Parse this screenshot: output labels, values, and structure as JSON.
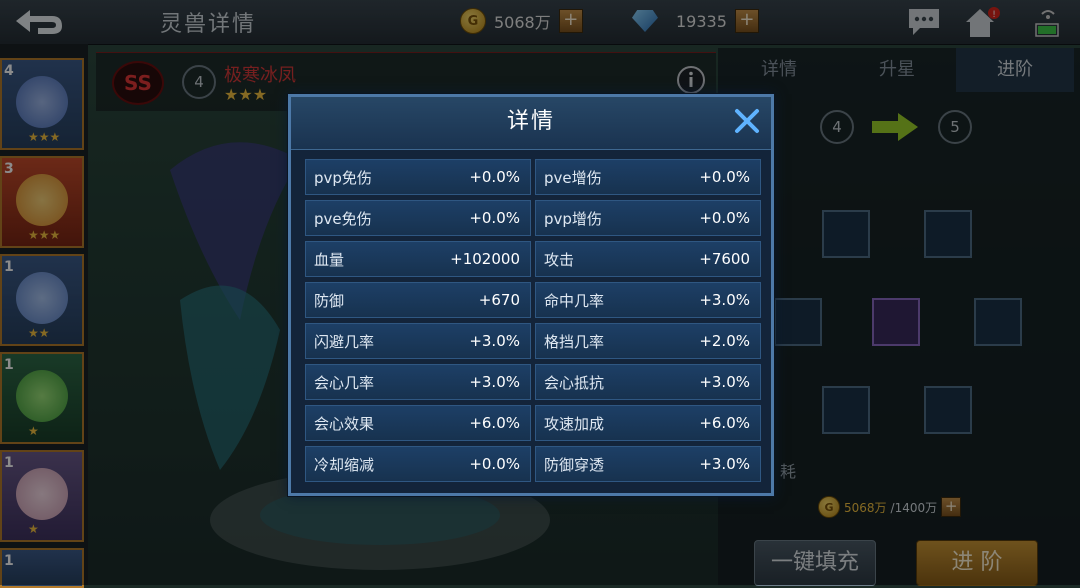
{
  "header": {
    "title": "灵兽详情",
    "gold": "5068万",
    "diamond": "19335"
  },
  "pet": {
    "grade": "SS",
    "level": "4",
    "name": "极寒冰凤",
    "stars": "★★★"
  },
  "left_list": [
    {
      "level": "4",
      "stars": "★★★"
    },
    {
      "level": "3",
      "stars": "★★★"
    },
    {
      "level": "1",
      "stars": "★★"
    },
    {
      "level": "1",
      "stars": "★"
    },
    {
      "level": "1",
      "stars": "★"
    },
    {
      "level": "1",
      "stars": ""
    }
  ],
  "tabs": [
    "详情",
    "升星",
    "进阶"
  ],
  "advance": {
    "from": "4",
    "to": "5",
    "cost_owned": "5068万",
    "cost_needed": "/1400万",
    "cost_label": "耗",
    "fill_button": "一键填充",
    "advance_button": "进 阶"
  },
  "modal": {
    "title": "详情",
    "stats": [
      {
        "label": "pvp免伤",
        "value": "+0.0%"
      },
      {
        "label": "pve增伤",
        "value": "+0.0%"
      },
      {
        "label": "pve免伤",
        "value": "+0.0%"
      },
      {
        "label": "pvp增伤",
        "value": "+0.0%"
      },
      {
        "label": "血量",
        "value": "+102000"
      },
      {
        "label": "攻击",
        "value": "+7600"
      },
      {
        "label": "防御",
        "value": "+670"
      },
      {
        "label": "命中几率",
        "value": "+3.0%"
      },
      {
        "label": "闪避几率",
        "value": "+3.0%"
      },
      {
        "label": "格挡几率",
        "value": "+2.0%"
      },
      {
        "label": "会心几率",
        "value": "+3.0%"
      },
      {
        "label": "会心抵抗",
        "value": "+3.0%"
      },
      {
        "label": "会心效果",
        "value": "+6.0%"
      },
      {
        "label": "攻速加成",
        "value": "+6.0%"
      },
      {
        "label": "冷却缩减",
        "value": "+0.0%"
      },
      {
        "label": "防御穿透",
        "value": "+3.0%"
      }
    ]
  },
  "colors": {
    "modal_bg": "#13243a",
    "modal_border": "#4d79a8",
    "accent_gold": "#f2c040",
    "grade_red": "#e23838"
  }
}
